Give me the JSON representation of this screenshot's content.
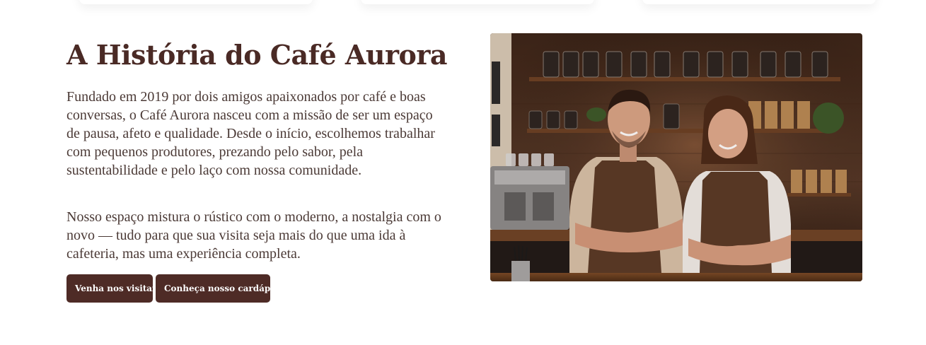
{
  "about": {
    "title": "A História do Café Aurora",
    "paragraph_1": "Fundado em 2019 por dois amigos apaixonados por café e boas conversas, o Café Aurora nasceu com a missão de ser um espaço de pausa, afeto e qualidade. Desde o início, escolhemos trabalhar com pequenos produtores, prezando pelo sabor, pela sustentabilidade e pelo laço com nossa comunidade.",
    "paragraph_2": "Nosso espaço mistura o rústico com o moderno, a nostalgia com o novo — tudo para que sua visita seja mais do que uma ida à cafeteria, mas uma experiência completa.",
    "buttons": {
      "visit_label": "Venha nos visitar!",
      "menu_label": "Conheça nosso cardápio!"
    }
  },
  "colors": {
    "brand": "#4e2b26",
    "text": "#4b3a36",
    "background": "#ffffff"
  }
}
